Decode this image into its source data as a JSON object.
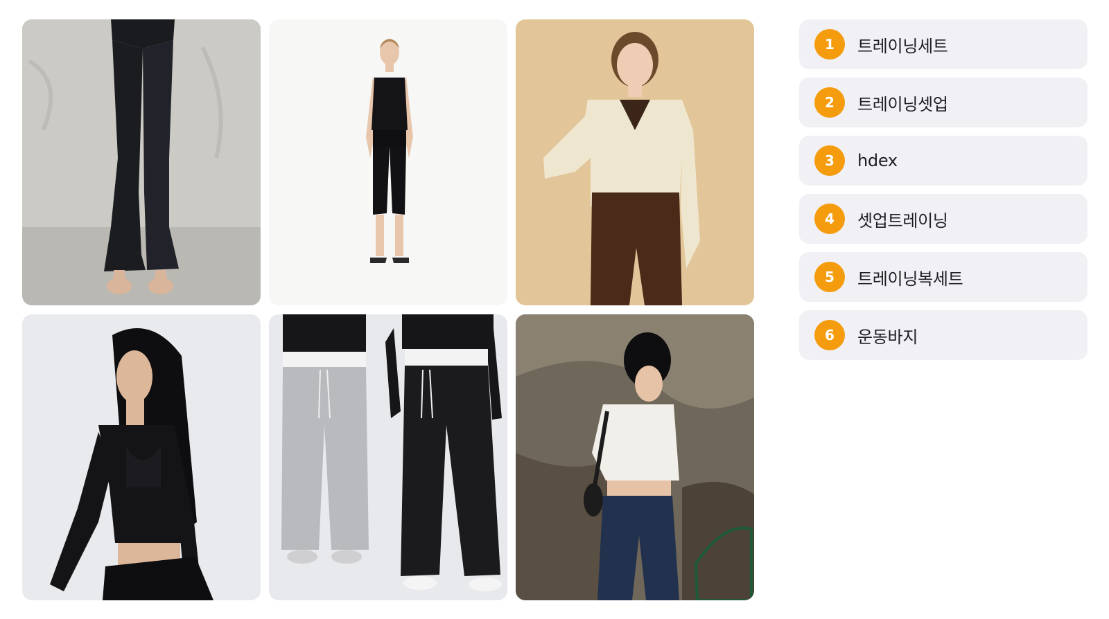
{
  "products": [
    {
      "name": "product-image-flare-leggings",
      "bg": "#c9c8c2",
      "garment": "#1b1c20"
    },
    {
      "name": "product-image-tank-capri-set",
      "bg": "#f6f6f4",
      "garment": "#121214"
    },
    {
      "name": "product-image-knit-top-brown-pants",
      "bg": "#e2c79a",
      "garment": "#4a2a18"
    },
    {
      "name": "product-image-black-cropped-top",
      "bg": "#e7e8ec",
      "garment": "#141416"
    },
    {
      "name": "product-image-wide-sweatpants",
      "bg": "#e6e7eb",
      "garment": "#1b1b1e"
    },
    {
      "name": "product-image-white-top-jeans",
      "bg": "#6b6458",
      "garment": "#22324e"
    }
  ],
  "ranking": {
    "accent": "#f49c0e",
    "items": [
      {
        "rank": "1",
        "label": "트레이닝세트"
      },
      {
        "rank": "2",
        "label": "트레이닝셋업"
      },
      {
        "rank": "3",
        "label": "hdex"
      },
      {
        "rank": "4",
        "label": "셋업트레이닝"
      },
      {
        "rank": "5",
        "label": "트레이닝복세트"
      },
      {
        "rank": "6",
        "label": "운동바지"
      }
    ]
  }
}
